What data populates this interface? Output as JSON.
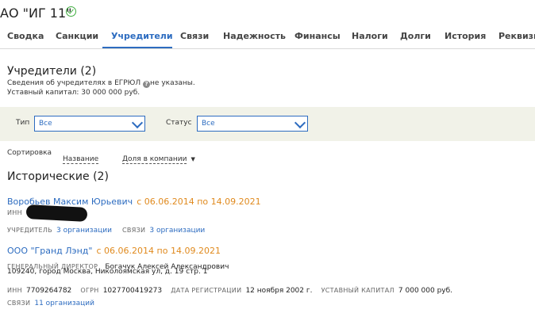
{
  "header": {
    "company_title": "АО \"ИГ 11\""
  },
  "tabs": [
    {
      "label": "Сводка"
    },
    {
      "label": "Санкции"
    },
    {
      "label": "Учредители"
    },
    {
      "label": "Связи"
    },
    {
      "label": "Надежность"
    },
    {
      "label": "Финансы"
    },
    {
      "label": "Налоги"
    },
    {
      "label": "Долги"
    },
    {
      "label": "История"
    },
    {
      "label": "Реквизиты"
    }
  ],
  "founders": {
    "title": "Учредители (2)",
    "note_before": "Сведения об учредителях в ЕГРЮЛ",
    "note_after": "не указаны.",
    "capital": "Уставный капитал: 30 000 000 руб."
  },
  "filters": {
    "type_label": "Тип",
    "type_value": "Все",
    "status_label": "Статус",
    "status_value": "Все"
  },
  "sort": {
    "label": "Сортировка",
    "option_name": "Название",
    "option_share": "Доля в компании"
  },
  "historical": {
    "title": "Исторические (2)",
    "items": [
      {
        "name": "Воробьев Максим Юрьевич",
        "period": "с 06.06.2014 по 14.09.2021",
        "inn_label": "ИНН",
        "founder_label": "УЧРЕДИТЕЛЬ",
        "founder_value": "3 организации",
        "links_label": "СВЯЗИ",
        "links_value": "3 организации"
      },
      {
        "name": "ООО \"Гранд Лэнд\"",
        "period": "с 06.06.2014 по 14.09.2021",
        "director_label": "ГЕНЕРАЛЬНЫЙ ДИРЕКТОР",
        "director_value": "Богачук Алексей Александрович",
        "address": "109240, город Москва, Николоямская ул, д. 19 стр. 1",
        "inn_label": "ИНН",
        "inn_value": "7709264782",
        "ogrn_label": "ОГРН",
        "ogrn_value": "1027700419273",
        "reg_label": "ДАТА РЕГИСТРАЦИИ",
        "reg_value": "12 ноября 2002 г.",
        "capital_label": "УСТАВНЫЙ КАПИТАЛ",
        "capital_value": "7 000 000 руб.",
        "links_label": "СВЯЗИ",
        "links_value": "11 организаций"
      }
    ]
  }
}
